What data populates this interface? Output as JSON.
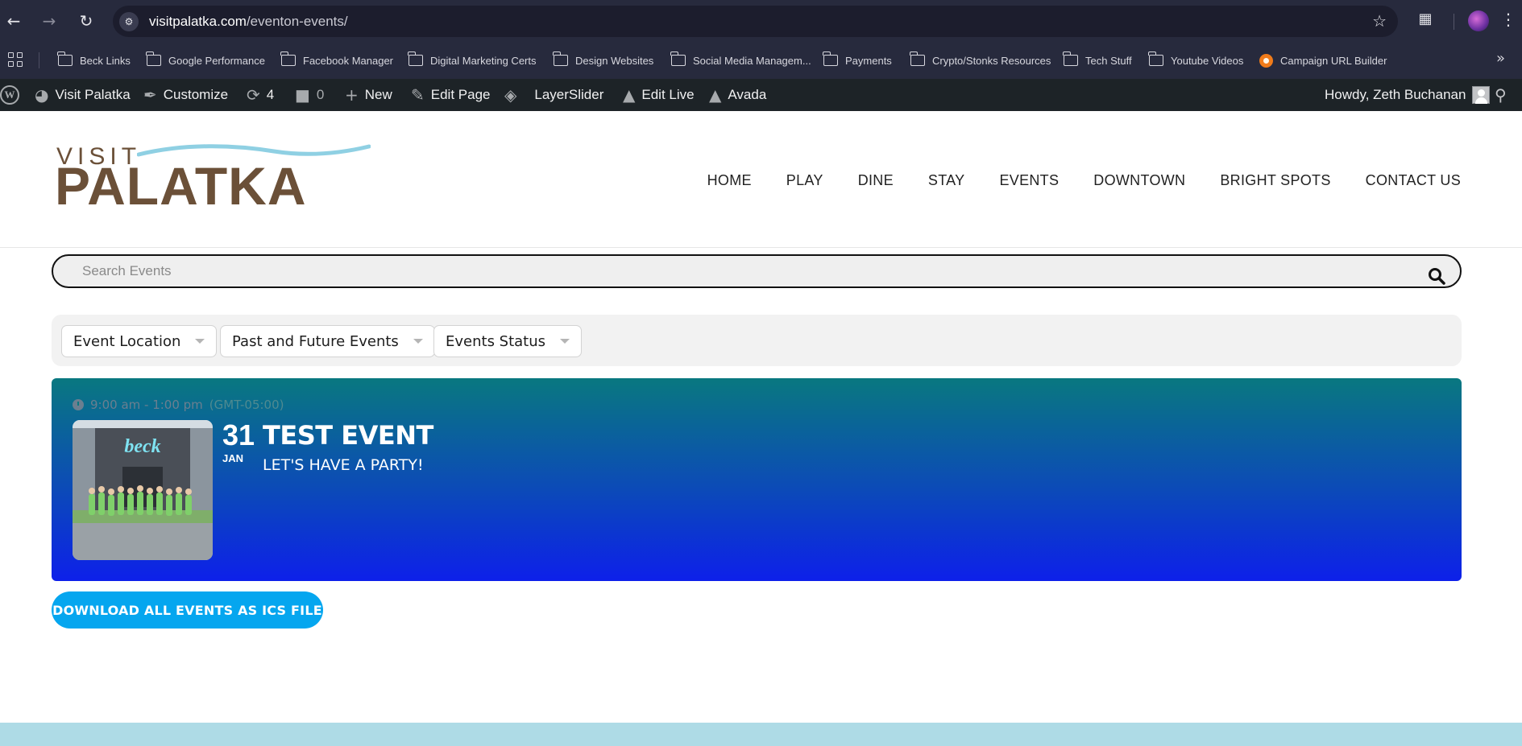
{
  "browser": {
    "url_host": "visitpalatka.com",
    "url_path": "/eventon-events/",
    "bookmarks": [
      {
        "label": "Beck Links"
      },
      {
        "label": "Google Performance"
      },
      {
        "label": "Facebook Manager"
      },
      {
        "label": "Digital Marketing Certs"
      },
      {
        "label": "Design Websites"
      },
      {
        "label": "Social Media Managem..."
      },
      {
        "label": "Payments"
      },
      {
        "label": "Crypto/Stonks Resources"
      },
      {
        "label": "Tech Stuff"
      },
      {
        "label": "Youtube Videos"
      },
      {
        "label": "Campaign URL Builder"
      }
    ]
  },
  "wpbar": {
    "site": "Visit Palatka",
    "customize": "Customize",
    "updates": "4",
    "comments": "0",
    "new": "New",
    "edit_page": "Edit Page",
    "layerslider": "LayerSlider",
    "edit_live": "Edit Live",
    "avada": "Avada",
    "howdy": "Howdy, Zeth Buchanan"
  },
  "header": {
    "logo_top": "VISIT",
    "logo_main": "PALATKA",
    "nav": [
      "HOME",
      "PLAY",
      "DINE",
      "STAY",
      "EVENTS",
      "DOWNTOWN",
      "BRIGHT SPOTS",
      "CONTACT US"
    ]
  },
  "search": {
    "placeholder": "Search Events"
  },
  "filters": [
    "Event Location",
    "Past and Future Events",
    "Events Status"
  ],
  "event": {
    "time": "9:00 am - 1:00 pm",
    "timezone": "(GMT-05:00)",
    "day": "31",
    "month": "JAN",
    "title": "TEST EVENT",
    "subtitle": "LET'S HAVE A PARTY!",
    "image_sign": "beck"
  },
  "download_button": "DOWNLOAD ALL EVENTS AS ICS FILE",
  "colors": {
    "brand_brown": "#6b5038",
    "accent_blue": "#05a6ef",
    "card_top": "#097880",
    "card_bottom": "#0d20ea",
    "footer": "#aedbe6"
  }
}
